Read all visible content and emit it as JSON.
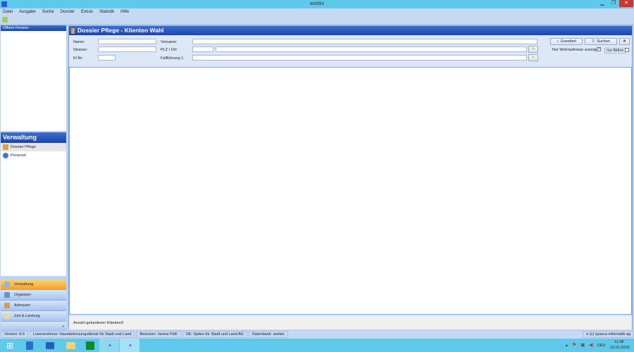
{
  "window": {
    "title": "asebis",
    "min": "▁",
    "max": "❐",
    "close": "✕"
  },
  "menu": [
    "Datei",
    "Ausgabe",
    "Suche",
    "Dossier",
    "Extras",
    "Statistik",
    "Hilfe"
  ],
  "left": {
    "open_windows": "Offene Fenster",
    "section_title": "Verwaltung",
    "items": [
      {
        "label": "Dossier Pflege",
        "icon": "folder-icon"
      },
      {
        "label": "Personal",
        "icon": "person-icon"
      }
    ],
    "nav": [
      {
        "label": "Verwaltung",
        "active": true
      },
      {
        "label": "Organizer"
      },
      {
        "label": "Adressen"
      },
      {
        "label": "Zeit & Leistung"
      }
    ],
    "nav_more": "»"
  },
  "main": {
    "title": "Dossier Pflege - Klienten Wahl",
    "form": {
      "name_label": "Name:",
      "name": "",
      "strasse_label": "Strasse:",
      "strasse": "",
      "klnr_label": "Kl Nr:",
      "klnr": "",
      "vorname_label": "Vorname:",
      "vorname": "",
      "plz_label": "PLZ / Ort:",
      "plz": "",
      "ort": "",
      "fall_label": "Fallführung 1:",
      "fall": ""
    },
    "buttons": {
      "erweitert": "Erweitert",
      "suchen": "Suchen"
    },
    "checks": {
      "wohnadresse": "Nur Wohnadresse anzeigen",
      "wohnadresse_checked": true,
      "aktive": "nur Aktive",
      "aktive_checked": false
    },
    "footer": {
      "label": "Anzahl gefundener Klienten:",
      "count": "0"
    }
  },
  "status": [
    "Version: 8.6",
    "Lizenznehmer: Hausbetreuungsdienst für Stadt und Land",
    "Benutzer: Janine Pelli",
    "OE: Spitex für Stadt und Land AG",
    "Datenbank: asebis"
  ],
  "copyright": "(c) syseca informatik ag",
  "tray": {
    "lang": "DEU",
    "time": "11:38",
    "date": "12.01.2016"
  }
}
